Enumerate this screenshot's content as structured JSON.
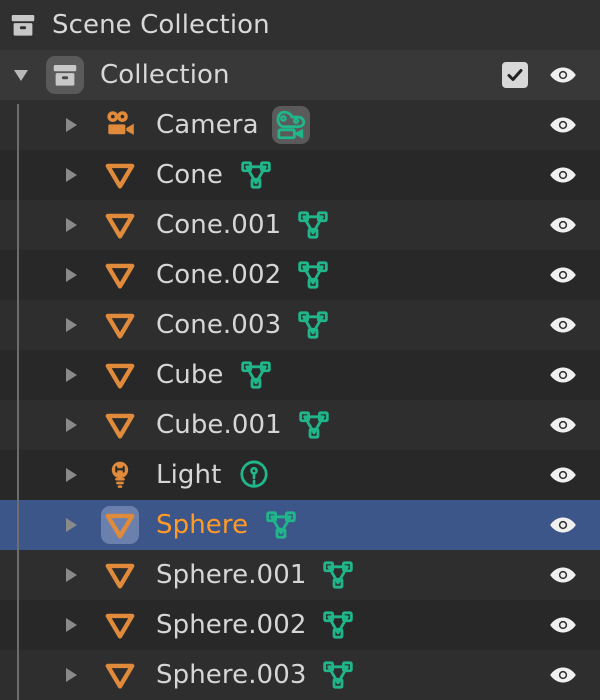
{
  "app": {
    "editor": "Outliner",
    "colors": {
      "background": "#2b2b2b",
      "row_light": "#2e2e2e",
      "row_dark": "#282828",
      "selection_blue": "#3c5689",
      "selected_text_orange": "#ff9a27",
      "object_icon_orange": "#e08a3c",
      "data_icon_green": "#21b58a",
      "text_gray": "#d6d6d6",
      "tree_line_gray": "#6d6d6d"
    }
  },
  "tree": {
    "scene_collection": {
      "label": "Scene Collection",
      "icon": "scene-collection-icon"
    },
    "collection": {
      "label": "Collection",
      "icon": "collection-icon",
      "expanded": true,
      "disclosure_icon": "chevron-down-icon",
      "checkbox_checked": true,
      "checkbox_icon": "checkmark-icon",
      "visibility_icon": "eye-icon"
    },
    "objects": [
      {
        "name": "Camera",
        "object_icon": "camera-object-icon",
        "data_icon": "camera-data-icon",
        "data_icon_highlighted": true,
        "disclosure_icon": "chevron-right-icon",
        "visibility_icon": "eye-icon",
        "selected": false,
        "stripe": "light",
        "object_icon_highlighted": false
      },
      {
        "name": "Cone",
        "object_icon": "mesh-object-icon",
        "data_icon": "mesh-data-icon",
        "data_icon_highlighted": false,
        "disclosure_icon": "chevron-right-icon",
        "visibility_icon": "eye-icon",
        "selected": false,
        "stripe": "dark",
        "object_icon_highlighted": false
      },
      {
        "name": "Cone.001",
        "object_icon": "mesh-object-icon",
        "data_icon": "mesh-data-icon",
        "data_icon_highlighted": false,
        "disclosure_icon": "chevron-right-icon",
        "visibility_icon": "eye-icon",
        "selected": false,
        "stripe": "light",
        "object_icon_highlighted": false
      },
      {
        "name": "Cone.002",
        "object_icon": "mesh-object-icon",
        "data_icon": "mesh-data-icon",
        "data_icon_highlighted": false,
        "disclosure_icon": "chevron-right-icon",
        "visibility_icon": "eye-icon",
        "selected": false,
        "stripe": "dark",
        "object_icon_highlighted": false
      },
      {
        "name": "Cone.003",
        "object_icon": "mesh-object-icon",
        "data_icon": "mesh-data-icon",
        "data_icon_highlighted": false,
        "disclosure_icon": "chevron-right-icon",
        "visibility_icon": "eye-icon",
        "selected": false,
        "stripe": "light",
        "object_icon_highlighted": false
      },
      {
        "name": "Cube",
        "object_icon": "mesh-object-icon",
        "data_icon": "mesh-data-icon",
        "data_icon_highlighted": false,
        "disclosure_icon": "chevron-right-icon",
        "visibility_icon": "eye-icon",
        "selected": false,
        "stripe": "dark",
        "object_icon_highlighted": false
      },
      {
        "name": "Cube.001",
        "object_icon": "mesh-object-icon",
        "data_icon": "mesh-data-icon",
        "data_icon_highlighted": false,
        "disclosure_icon": "chevron-right-icon",
        "visibility_icon": "eye-icon",
        "selected": false,
        "stripe": "light",
        "object_icon_highlighted": false
      },
      {
        "name": "Light",
        "object_icon": "light-object-icon",
        "data_icon": "point-light-data-icon",
        "data_icon_highlighted": false,
        "disclosure_icon": "chevron-right-icon",
        "visibility_icon": "eye-icon",
        "selected": false,
        "stripe": "dark",
        "object_icon_highlighted": false
      },
      {
        "name": "Sphere",
        "object_icon": "mesh-object-icon",
        "data_icon": "mesh-data-icon",
        "data_icon_highlighted": false,
        "disclosure_icon": "chevron-right-icon",
        "visibility_icon": "eye-icon",
        "selected": true,
        "stripe": "selected",
        "object_icon_highlighted": true
      },
      {
        "name": "Sphere.001",
        "object_icon": "mesh-object-icon",
        "data_icon": "mesh-data-icon",
        "data_icon_highlighted": false,
        "disclosure_icon": "chevron-right-icon",
        "visibility_icon": "eye-icon",
        "selected": false,
        "stripe": "light",
        "object_icon_highlighted": false
      },
      {
        "name": "Sphere.002",
        "object_icon": "mesh-object-icon",
        "data_icon": "mesh-data-icon",
        "data_icon_highlighted": false,
        "disclosure_icon": "chevron-right-icon",
        "visibility_icon": "eye-icon",
        "selected": false,
        "stripe": "dark",
        "object_icon_highlighted": false
      },
      {
        "name": "Sphere.003",
        "object_icon": "mesh-object-icon",
        "data_icon": "mesh-data-icon",
        "data_icon_highlighted": false,
        "disclosure_icon": "chevron-right-icon",
        "visibility_icon": "eye-icon",
        "selected": false,
        "stripe": "light",
        "object_icon_highlighted": false
      }
    ]
  }
}
